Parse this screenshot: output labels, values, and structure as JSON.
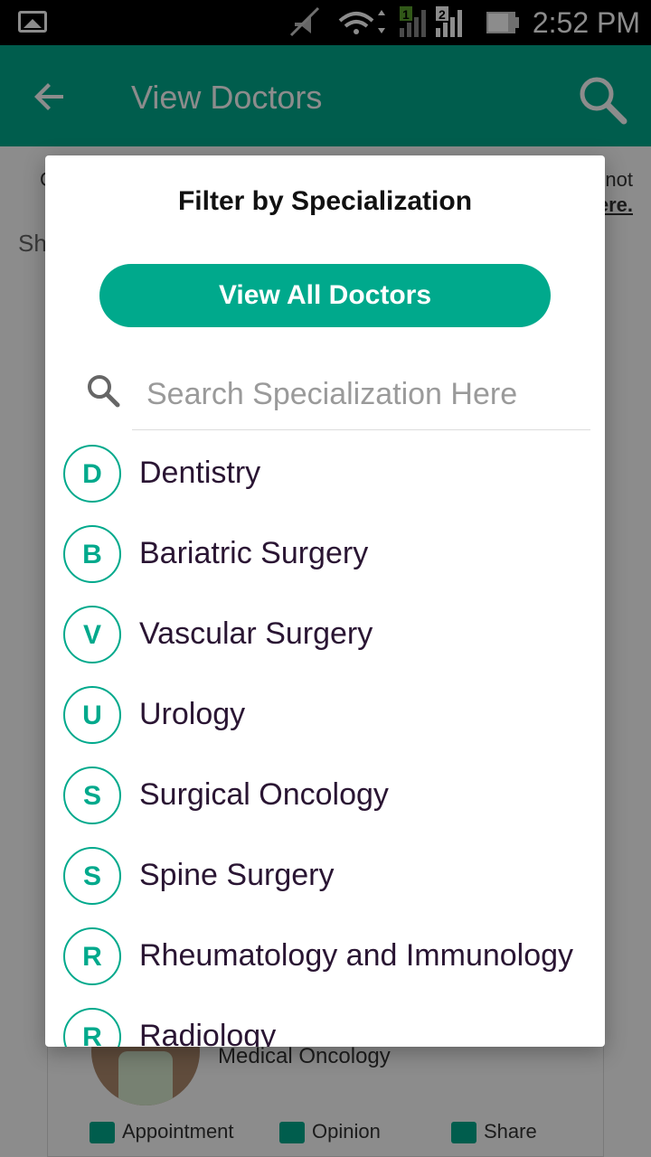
{
  "status_bar": {
    "time": "2:52 PM",
    "sim1": "1",
    "sim2": "2"
  },
  "app_bar": {
    "title": "View Doctors"
  },
  "background": {
    "note_left": "C",
    "note_right_1": "not",
    "note_right_2": "ere.",
    "showing": "Sh",
    "card_specialization": "Medical Oncology",
    "actions": [
      "Appointment",
      "Opinion",
      "Share"
    ]
  },
  "dialog": {
    "title": "Filter by Specialization",
    "view_all_label": "View All Doctors",
    "search_placeholder": "Search Specialization Here",
    "search_value": "",
    "items": [
      {
        "initial": "D",
        "label": "Dentistry"
      },
      {
        "initial": "B",
        "label": "Bariatric Surgery"
      },
      {
        "initial": "V",
        "label": "Vascular Surgery"
      },
      {
        "initial": "U",
        "label": "Urology"
      },
      {
        "initial": "S",
        "label": "Surgical Oncology"
      },
      {
        "initial": "S",
        "label": "Spine Surgery"
      },
      {
        "initial": "R",
        "label": "Rheumatology and Immunology"
      },
      {
        "initial": "R",
        "label": "Radiology"
      }
    ]
  },
  "colors": {
    "accent": "#00a98c",
    "text_primary": "#2a1533"
  },
  "icons": [
    "gallery-icon",
    "mute-icon",
    "wifi-icon",
    "signal-icon",
    "battery-icon",
    "back-arrow-icon",
    "search-icon"
  ]
}
